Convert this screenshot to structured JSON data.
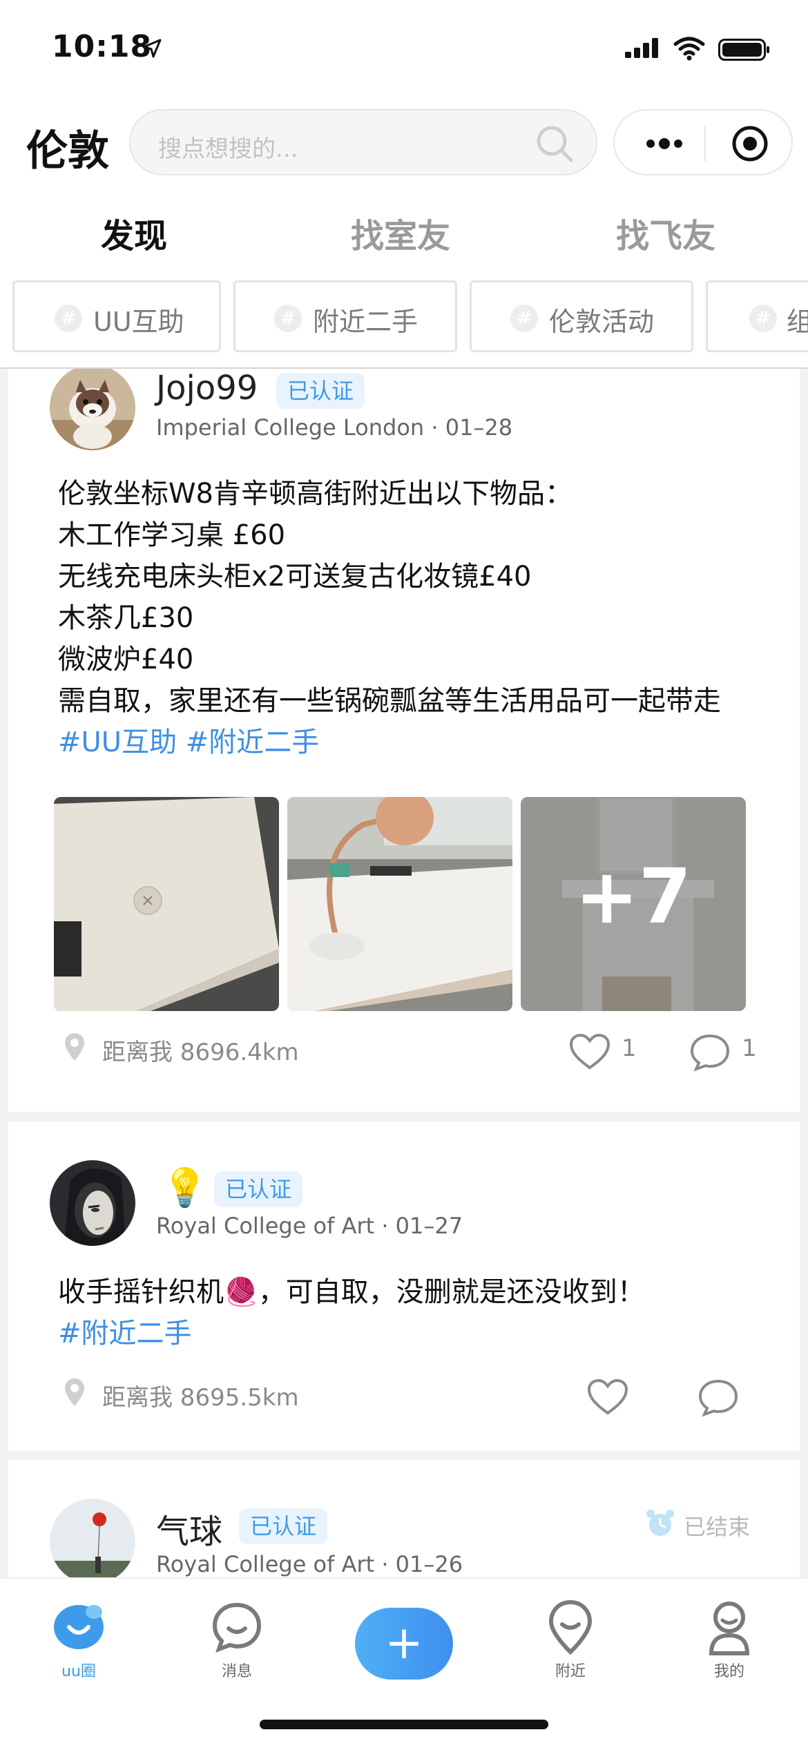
{
  "status_bar": {
    "time": "10:18"
  },
  "header": {
    "city": "伦敦",
    "search_placeholder": "搜点想搜的..."
  },
  "tabs": [
    {
      "label": "发现",
      "active": true
    },
    {
      "label": "找室友",
      "active": false
    },
    {
      "label": "找飞友",
      "active": false
    }
  ],
  "chips": [
    {
      "label": "UU互助"
    },
    {
      "label": "附近二手"
    },
    {
      "label": "伦敦活动"
    },
    {
      "label": "组"
    }
  ],
  "posts": [
    {
      "username": "Jojo99",
      "badge": "已认证",
      "meta": "Imperial College London · 01–28",
      "lines": [
        "伦敦坐标W8肯辛顿高街附近出以下物品：",
        "木工作学习桌 £60",
        "无线充电床头柜x2可送复古化妆镜£40",
        "木茶几£30",
        "微波炉£40",
        "需自取，家里还有一些锅碗瓢盆等生活用品可一起带走"
      ],
      "tags": "#UU互助 #附近二手",
      "more_images": "+7",
      "distance": "距离我 8696.4km",
      "likes": "1",
      "comments": "1"
    },
    {
      "username": "💡",
      "badge": "已认证",
      "meta": "Royal College of Art · 01–27",
      "lines": [
        "收手摇针织机🧶，可自取，没删就是还没收到！"
      ],
      "tags": "#附近二手",
      "distance": "距离我 8695.5km"
    },
    {
      "username": "气球",
      "badge": "已认证",
      "meta": "Royal College of Art · 01–26",
      "status": "已结束"
    }
  ],
  "bottom_nav": [
    {
      "label": "uu圈",
      "active": true
    },
    {
      "label": "消息",
      "active": false
    },
    {
      "label": "附近",
      "active": false
    },
    {
      "label": "我的",
      "active": false
    }
  ],
  "colors": {
    "accent": "#3d9be9",
    "tag": "#3d8fe4",
    "badge_bg": "#e9f3fd"
  }
}
